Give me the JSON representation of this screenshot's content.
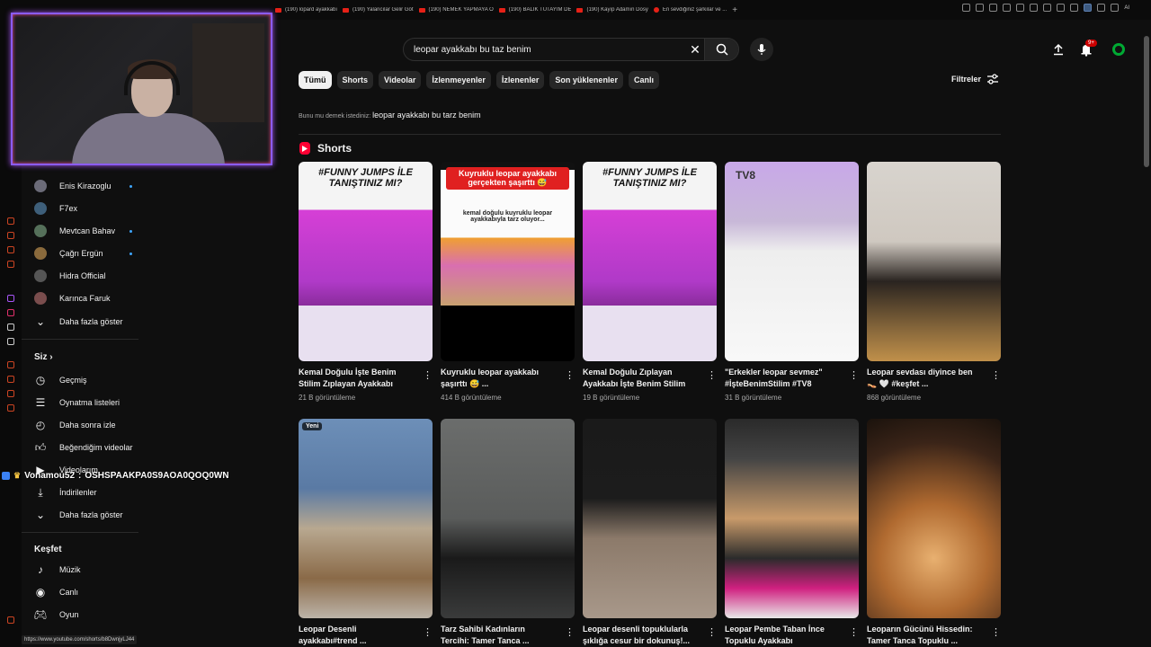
{
  "browser": {
    "tabs": [
      "(190) lopard ayakkabı",
      "(190) Yalancılar Gelir Göt",
      "(190) NEMEK YAPMAYA Ö",
      "(190) BALIK TUTAYIM DE",
      "(190) Kayıp Adamın Dosy",
      "En sevdiğiniz şarkılar ve ..."
    ],
    "new_tab": "+",
    "ext_label": "AI"
  },
  "search": {
    "query": "leopar ayakkabı bu taz benim"
  },
  "header": {
    "notification_count": "9+"
  },
  "chips": [
    "Tümü",
    "Shorts",
    "Videolar",
    "İzlenmeyenler",
    "İzlenenler",
    "Son yüklenenler",
    "Canlı"
  ],
  "filters_label": "Filtreler",
  "did_you_mean": {
    "prefix": "Bunu mu demek istediniz:",
    "suggestion": "leopar ayakkabı bu tarz benim"
  },
  "shorts_heading": "Shorts",
  "sidebar": {
    "subscriptions": [
      {
        "name": "Enis Kirazoglu",
        "live": true
      },
      {
        "name": "F7ex",
        "live": false
      },
      {
        "name": "Mevtcan Bahav",
        "live": true
      },
      {
        "name": "Çağrı Ergün",
        "live": true
      },
      {
        "name": "Hidra Official",
        "live": false
      },
      {
        "name": "Karınca Faruk",
        "live": false
      }
    ],
    "show_more_1": "Daha fazla göster",
    "you_heading": "Siz",
    "you_items": [
      "Geçmiş",
      "Oynatma listeleri",
      "Daha sonra izle",
      "Beğendiğim videolar",
      "Videolarım",
      "İndirilenler",
      "Daha fazla göster"
    ],
    "explore_heading": "Keşfet",
    "explore_items": [
      "Müzik",
      "Canlı",
      "Oyun"
    ]
  },
  "chat": {
    "user": "Vonamou52",
    "message": "OSHSPAAKPA0S9AOA0QOQ0WN"
  },
  "status_url": "https://www.youtube.com/shorts/b8DwnjyLJ44",
  "shorts": [
    {
      "title": "Kemal Doğulu İşte Benim Stilim Zıplayan Ayakkabı",
      "views": "21 B görüntüleme",
      "thumb_text": "#FUNNY JUMPS İLE TANIŞTINIZ MI?",
      "new": ""
    },
    {
      "title": "Kuyruklu leopar ayakkabı şaşırttı 😅 ...",
      "views": "414 B görüntüleme",
      "thumb_text": "Kuyruklu leopar ayakkabı gerçekten şaşırttı 😅",
      "thumb_text2": "kemal doğulu kuyruklu leopar ayakkabıyla tarz oluyor...",
      "new": ""
    },
    {
      "title": "Kemal Doğulu Zıplayan Ayakkabı İşte Benim Stilim",
      "views": "19 B görüntüleme",
      "thumb_text": "#FUNNY JUMPS İLE TANIŞTINIZ MI?",
      "new": ""
    },
    {
      "title": "\"Erkekler leopar sevmez\" #İşteBenimStilim #TV8",
      "views": "31 B görüntüleme",
      "thumb_text": "TV8",
      "new": ""
    },
    {
      "title": "Leopar sevdası diyince ben 👡 🤍 #keşfet ...",
      "views": "868 görüntüleme",
      "thumb_text": "",
      "new": ""
    },
    {
      "title": "Leopar Desenli ayakkabı#trend ...",
      "views": "",
      "thumb_text": "",
      "new": "Yeni"
    },
    {
      "title": "Tarz Sahibi Kadınların Tercihi: Tamer Tanca ...",
      "views": "",
      "thumb_text": "",
      "new": ""
    },
    {
      "title": "Leopar desenli topuklularla şıklığa cesur bir dokunuş!...",
      "views": "",
      "thumb_text": "",
      "new": ""
    },
    {
      "title": "Leopar Pembe Taban İnce Topuklu Ayakkabı",
      "views": "",
      "thumb_text": "",
      "new": ""
    },
    {
      "title": "Leoparın Gücünü Hissedin: Tamer Tanca Topuklu ...",
      "views": "",
      "thumb_text": "",
      "new": ""
    }
  ],
  "colors": {
    "background": "#0f0f0f",
    "accent_red": "#ff0033",
    "chip_active": "#f1f1f1",
    "webcam_border": "#8b5cf6"
  }
}
